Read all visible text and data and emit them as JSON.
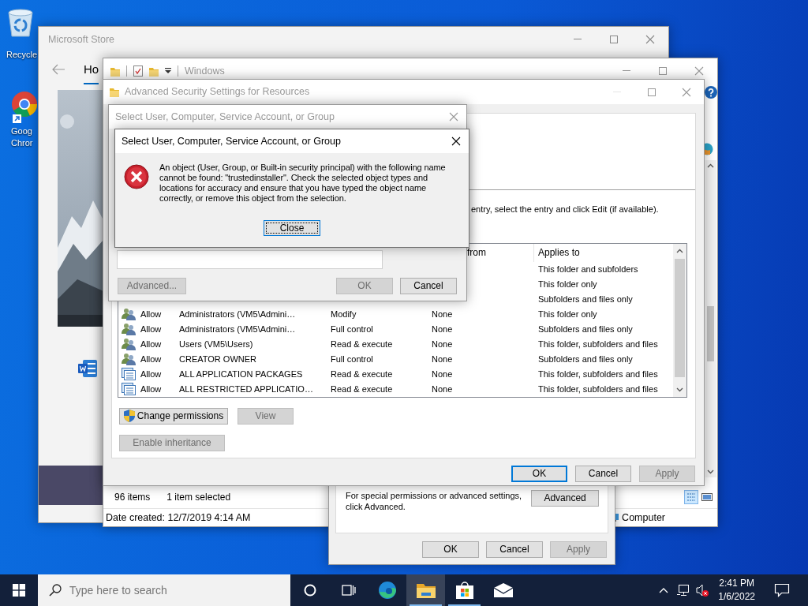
{
  "desktop": {
    "icons": [
      {
        "kind": "recycle-bin",
        "label_lines": [
          "Recycle"
        ]
      },
      {
        "kind": "chrome",
        "label_lines": [
          "Goog",
          "Chror"
        ]
      }
    ]
  },
  "store_window": {
    "title": "Microsoft Store",
    "active": false,
    "tab": "Ho"
  },
  "explorer_window": {
    "title": "Windows",
    "active": false,
    "status_bar": {
      "item_count": "96 items",
      "selection": "1 item selected"
    },
    "details_bar": {
      "date_created": "Date created: 12/7/2019 4:14 AM",
      "location": "Computer"
    }
  },
  "properties_dialog": {
    "note_lines": [
      "For special permissions or advanced settings,",
      "click Advanced."
    ],
    "advanced_button": "Advanced",
    "buttons": [
      {
        "label": "OK",
        "disabled": false
      },
      {
        "label": "Cancel",
        "disabled": false
      },
      {
        "label": "Apply",
        "disabled": true
      }
    ]
  },
  "advanced_security_window": {
    "title": "Advanced Security Settings for Resources",
    "active": false,
    "instruction": "entry, select the entry and click Edit (if available).",
    "table": {
      "columns": [
        "from",
        "Applies to"
      ],
      "rows": [
        {
          "applies_to": "This folder and subfolders"
        },
        {
          "applies_to": "This folder only"
        },
        {
          "applies_to": "Subfolders and files only"
        },
        {
          "kind": "user",
          "type": "Allow",
          "principal": "Administrators (VM5\\Admini…",
          "access": "Modify",
          "inherited_from": "None",
          "applies_to": "This folder only"
        },
        {
          "kind": "user",
          "type": "Allow",
          "principal": "Administrators (VM5\\Admini…",
          "access": "Full control",
          "inherited_from": "None",
          "applies_to": "Subfolders and files only"
        },
        {
          "kind": "user",
          "type": "Allow",
          "principal": "Users (VM5\\Users)",
          "access": "Read & execute",
          "inherited_from": "None",
          "applies_to": "This folder, subfolders and files"
        },
        {
          "kind": "user",
          "type": "Allow",
          "principal": "CREATOR OWNER",
          "access": "Full control",
          "inherited_from": "None",
          "applies_to": "Subfolders and files only"
        },
        {
          "kind": "package",
          "type": "Allow",
          "principal": "ALL APPLICATION PACKAGES",
          "access": "Read & execute",
          "inherited_from": "None",
          "applies_to": "This folder, subfolders and files"
        },
        {
          "kind": "package",
          "type": "Allow",
          "principal": "ALL RESTRICTED APPLICATIO…",
          "access": "Read & execute",
          "inherited_from": "None",
          "applies_to": "This folder, subfolders and files"
        }
      ]
    },
    "action_buttons": [
      {
        "label": "Change permissions",
        "kind": "shield",
        "disabled": false
      },
      {
        "label": "View",
        "kind": "plain",
        "disabled": true
      },
      {
        "label": "Enable inheritance",
        "kind": "plain",
        "disabled": true
      }
    ],
    "buttons": [
      {
        "label": "OK",
        "default": true,
        "disabled": false
      },
      {
        "label": "Cancel",
        "default": false,
        "disabled": false
      },
      {
        "label": "Apply",
        "default": false,
        "disabled": true
      }
    ]
  },
  "select_dialog": {
    "title": "Select User, Computer, Service Account, or Group",
    "active": false,
    "buttons": [
      {
        "label": "Advanced...",
        "disabled": true
      },
      {
        "label": "OK",
        "disabled": true
      },
      {
        "label": "Cancel",
        "disabled": false
      }
    ]
  },
  "error_dialog": {
    "title": "Select User, Computer, Service Account, or Group",
    "active": true,
    "message": "An object (User, Group, or Built-in security principal) with the following name cannot be found: \"trustedinstaller\". Check the selected object types and locations for accuracy and ensure that you have typed the object name correctly, or remove this object from the selection.",
    "button": "Close"
  },
  "taskbar": {
    "search": {
      "placeholder": "Type here to search"
    },
    "apps": [
      {
        "kind": "cortana",
        "active": false,
        "running": false
      },
      {
        "kind": "task-view",
        "active": false,
        "running": false
      },
      {
        "kind": "edge",
        "active": false,
        "running": false
      },
      {
        "kind": "explorer",
        "active": true,
        "running": true
      },
      {
        "kind": "store",
        "active": false,
        "running": true
      },
      {
        "kind": "mail",
        "active": false,
        "running": false
      }
    ],
    "clock": {
      "time": "2:41 PM",
      "date": "1/6/2022"
    }
  }
}
